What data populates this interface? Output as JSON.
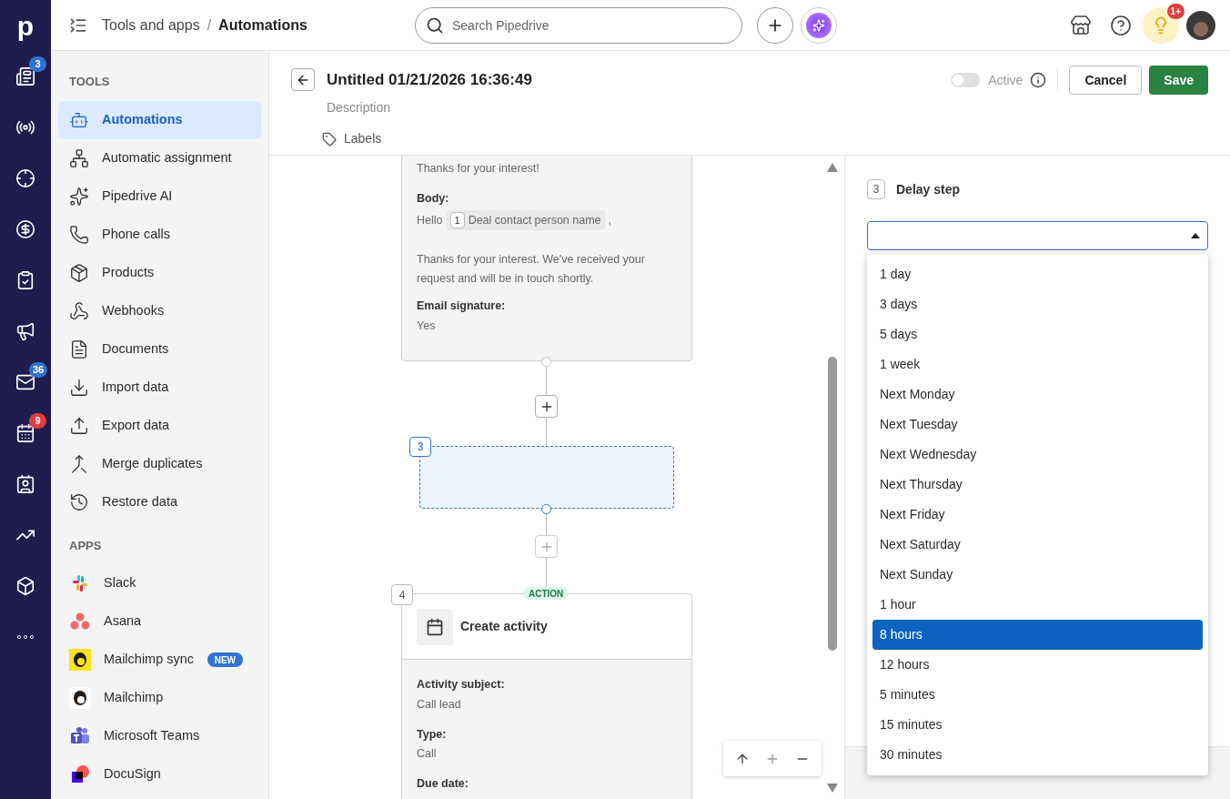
{
  "rail": {
    "logo": "p",
    "items": [
      {
        "kind": "leads",
        "badge": "3",
        "urgent": false
      },
      {
        "kind": "broadcast"
      },
      {
        "kind": "target"
      },
      {
        "kind": "deals"
      },
      {
        "kind": "tasks"
      },
      {
        "kind": "campaigns"
      },
      {
        "kind": "mail",
        "badge": "36",
        "urgent": false
      },
      {
        "kind": "calendar",
        "badge": "9",
        "urgent": true
      },
      {
        "kind": "contacts"
      },
      {
        "kind": "insights"
      },
      {
        "kind": "products"
      },
      {
        "kind": "more"
      }
    ]
  },
  "topbar": {
    "breadcrumb": [
      "Tools and apps",
      "Automations"
    ],
    "separator": "/",
    "search": {
      "placeholder": "Search Pipedrive"
    },
    "notification_badge": "1+"
  },
  "sidebar": {
    "sections": [
      {
        "title": "TOOLS",
        "items": [
          {
            "label": "Automations",
            "selected": true
          },
          {
            "label": "Automatic assignment",
            "selected": false
          },
          {
            "label": "Pipedrive AI",
            "selected": false
          },
          {
            "label": "Phone calls",
            "selected": false
          },
          {
            "label": "Products",
            "selected": false
          },
          {
            "label": "Webhooks",
            "selected": false
          },
          {
            "label": "Documents",
            "selected": false
          },
          {
            "label": "Import data",
            "selected": false
          },
          {
            "label": "Export data",
            "selected": false
          },
          {
            "label": "Merge duplicates",
            "selected": false
          },
          {
            "label": "Restore data",
            "selected": false
          }
        ]
      },
      {
        "title": "APPS",
        "items": [
          {
            "label": "Slack",
            "selected": false
          },
          {
            "label": "Asana",
            "selected": false
          },
          {
            "label": "Mailchimp sync",
            "selected": false,
            "badge": "NEW"
          },
          {
            "label": "Mailchimp",
            "selected": false
          },
          {
            "label": "Microsoft Teams",
            "selected": false
          },
          {
            "label": "DocuSign",
            "selected": false
          }
        ]
      }
    ]
  },
  "editor": {
    "title": "Untitled 01/21/2026 16:36:49",
    "description": "Description",
    "labels": "Labels",
    "active": {
      "on": false,
      "label": "Active"
    },
    "buttons": {
      "cancel": "Cancel",
      "save": "Save"
    }
  },
  "canvas": {
    "email_card": {
      "subject_value": "Thanks for your interest!",
      "fields": [
        {
          "label": "Body:",
          "greeting": "Hello",
          "token_index": "1",
          "token": "Deal contact person name",
          "after_token": ",",
          "body_text": "Thanks for your interest. We've received your request and will be in touch shortly."
        },
        {
          "label": "Email signature:",
          "value": "Yes"
        }
      ]
    },
    "delay_step": {
      "number": "3"
    },
    "action_card": {
      "number": "4",
      "tag": "ACTION",
      "title": "Create activity",
      "fields": [
        {
          "label": "Activity subject:",
          "value": "Call lead"
        },
        {
          "label": "Type:",
          "value": "Call"
        },
        {
          "label": "Due date:"
        }
      ]
    }
  },
  "delay_panel": {
    "number": "3",
    "title": "Delay step",
    "select": {
      "expanded": true
    },
    "options": [
      {
        "label": "1 day",
        "selected": false
      },
      {
        "label": "3 days",
        "selected": false
      },
      {
        "label": "5 days",
        "selected": false
      },
      {
        "label": "1 week",
        "selected": false
      },
      {
        "label": "Next Monday",
        "selected": false
      },
      {
        "label": "Next Tuesday",
        "selected": false
      },
      {
        "label": "Next Wednesday",
        "selected": false
      },
      {
        "label": "Next Thursday",
        "selected": false
      },
      {
        "label": "Next Friday",
        "selected": false
      },
      {
        "label": "Next Saturday",
        "selected": false
      },
      {
        "label": "Next Sunday",
        "selected": false
      },
      {
        "label": "1 hour",
        "selected": false
      },
      {
        "label": "8 hours",
        "selected": true
      },
      {
        "label": "12 hours",
        "selected": false
      },
      {
        "label": "5 minutes",
        "selected": false
      },
      {
        "label": "15 minutes",
        "selected": false
      },
      {
        "label": "30 minutes",
        "selected": false
      }
    ]
  }
}
